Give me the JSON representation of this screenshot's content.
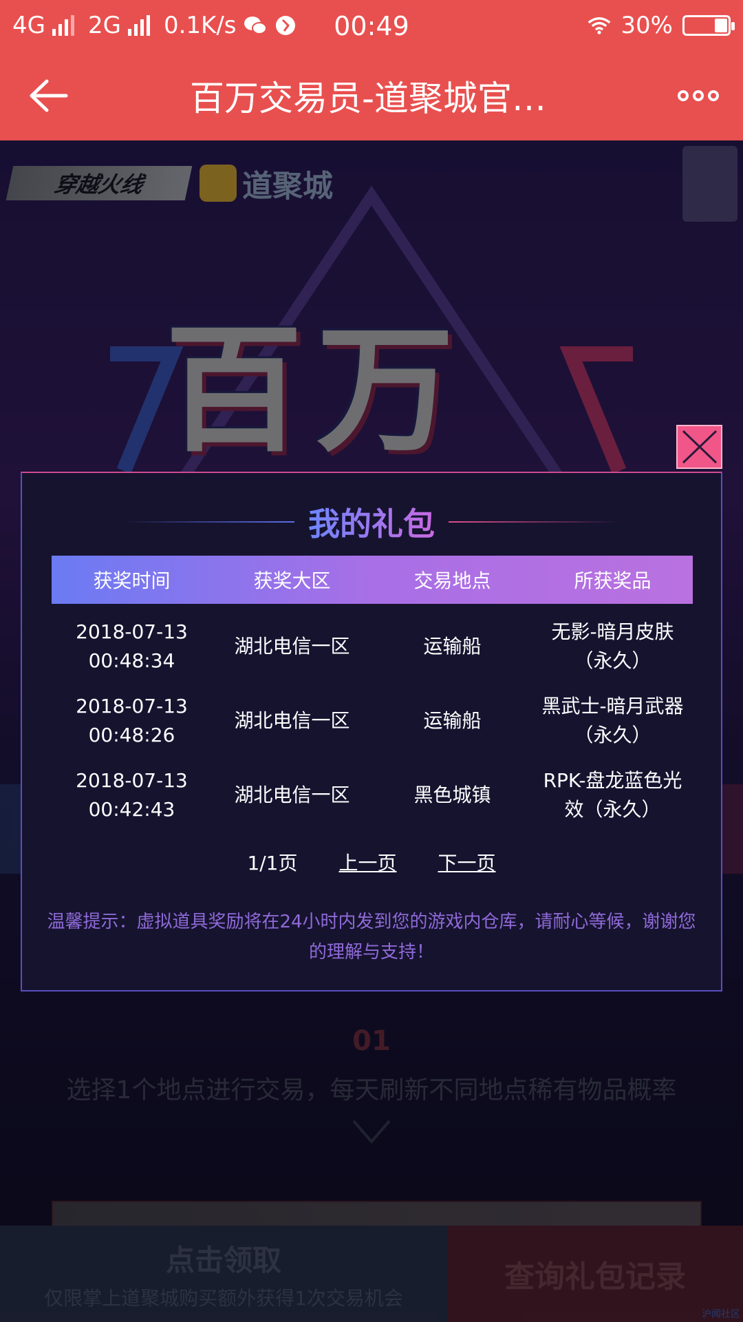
{
  "status_bar": {
    "network1": "4G",
    "network2": "2G",
    "speed": "0.1K/s",
    "time": "00:49",
    "battery": "30%",
    "battery_level": 0.3
  },
  "title_bar": {
    "title": "百万交易员-道聚城官…"
  },
  "background": {
    "cf_logo": "穿越火线",
    "dj_logo": "道聚城",
    "hero": "百万",
    "subtitle": "选择1个地点进行交易，每天刷新不同地点稀有物品概率",
    "ecent": "01"
  },
  "bottom": {
    "claim_main": "点击领取",
    "claim_sub": "仅限掌上道聚城购买额外获得1次交易机会",
    "query": "查询礼包记录",
    "watermark": "沪闻社区"
  },
  "modal": {
    "title": "我的礼包",
    "headers": [
      "获奖时间",
      "获奖大区",
      "交易地点",
      "所获奖品"
    ],
    "rows": [
      [
        "2018-07-13\n00:48:34",
        "湖北电信一区",
        "运输船",
        "无影-暗月皮肤\n（永久）"
      ],
      [
        "2018-07-13\n00:48:26",
        "湖北电信一区",
        "运输船",
        "黑武士-暗月武器\n（永久）"
      ],
      [
        "2018-07-13\n00:42:43",
        "湖北电信一区",
        "黑色城镇",
        "RPK-盘龙蓝色光\n效（永久）"
      ]
    ],
    "page_info": "1/1页",
    "prev": "上一页",
    "next": "下一页",
    "tip": "温馨提示：虚拟道具奖励将在24小时内发到您的游戏内仓库，请耐心等候，谢谢您的理解与支持！"
  }
}
